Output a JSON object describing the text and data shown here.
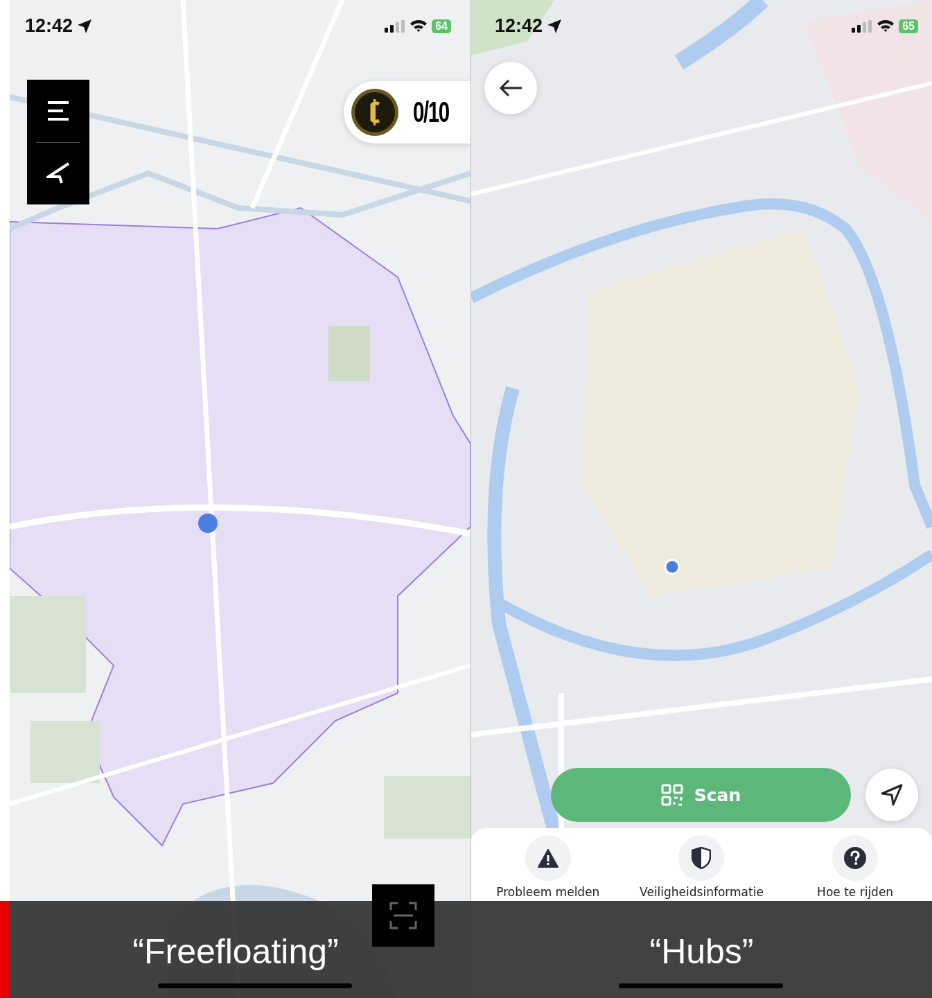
{
  "freefloating_screen": {
    "status_bar": {
      "time": "12:42",
      "battery": "64"
    },
    "coin_counter": "0/10",
    "caption": "“Freefloating”"
  },
  "hubs_screen": {
    "status_bar": {
      "time": "12:42",
      "battery": "65"
    },
    "scan_button": "Scan",
    "caption": "“Hubs”",
    "sheet_actions": [
      {
        "kind": "warning",
        "label": "Probleem melden"
      },
      {
        "kind": "shield",
        "label": "Veiligheidsinformatie"
      },
      {
        "kind": "help",
        "label": "Hoe te rijden"
      }
    ]
  }
}
